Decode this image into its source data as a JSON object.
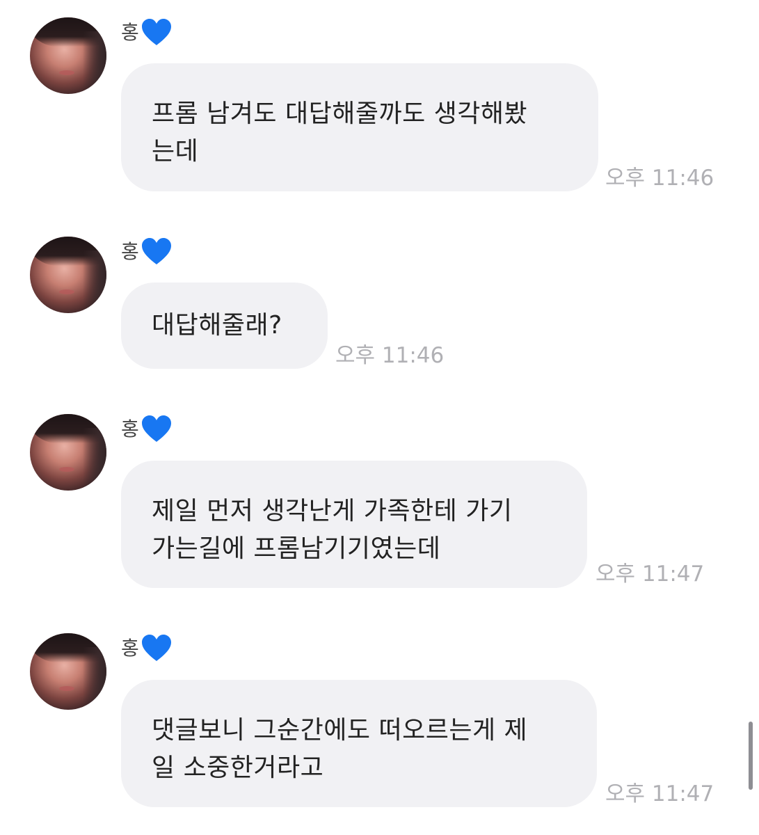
{
  "messages": [
    {
      "sender": "홍",
      "lines": [
        "프롬 남겨도 대답해줄까도 생각해봤",
        "는데"
      ],
      "time": "오후 11:46"
    },
    {
      "sender": "홍",
      "lines": [
        "대답해줄래?"
      ],
      "time": "오후 11:46"
    },
    {
      "sender": "홍",
      "lines": [
        "제일 먼저 생각난게 가족한테 가기",
        "가는길에 프롬남기기였는데"
      ],
      "time": "오후 11:47"
    },
    {
      "sender": "홍",
      "lines": [
        "댓글보니 그순간에도 떠오르는게 제",
        "일 소중한거라고"
      ],
      "time": "오후 11:47"
    }
  ],
  "colors": {
    "bubble": "#f1f1f4",
    "heart": "#1877f2",
    "time": "#b0b0b4"
  }
}
